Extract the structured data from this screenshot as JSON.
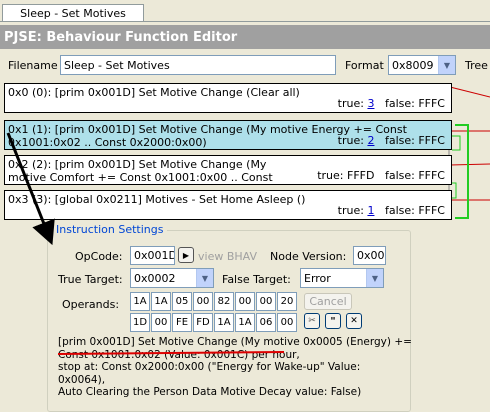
{
  "tab": {
    "label": "Sleep - Set Motives"
  },
  "header": {
    "title": "PJSE: Behaviour Function Editor"
  },
  "filename": {
    "label": "Filename",
    "value": "Sleep - Set Motives"
  },
  "format": {
    "label": "Format",
    "value": "0x8009"
  },
  "tree": {
    "label": "Tree"
  },
  "nodes": [
    {
      "text": "0x0 (0): [prim 0x001D] Set Motive Change (Clear all)",
      "true_label": "true:",
      "true_val": "3",
      "false_label": "false:",
      "false_val": "FFFC"
    },
    {
      "text": "0x1 (1): [prim 0x001D] Set Motive Change (My motive Energy += Const 0x1001:0x02 .. Const 0x2000:0x00)",
      "true_label": "true:",
      "true_val": "2",
      "false_label": "false:",
      "false_val": "FFFC"
    },
    {
      "text": "0x2 (2): [prim 0x001D] Set Motive Change (My motive Comfort += Const 0x1001:0x00 .. Const 0x1001:0x01)",
      "true_label": "true:",
      "true_val": "FFFD",
      "false_label": "false:",
      "false_val": "FFFC"
    },
    {
      "text": "0x3 (3): [global 0x0211] Motives - Set Home Asleep ()",
      "true_label": "true:",
      "true_val": "1",
      "false_label": "false:",
      "false_val": "FFFC"
    }
  ],
  "settings": {
    "title": "Instruction Settings",
    "opcode_label": "OpCode:",
    "opcode_value": "0x001D",
    "view_bhav": "view BHAV",
    "node_version_label": "Node Version:",
    "node_version_value": "0x00",
    "true_target_label": "True Target:",
    "true_target_value": "0x0002",
    "false_target_label": "False Target:",
    "false_target_value": "Error",
    "operands_label": "Operands:",
    "operands_row1": [
      "1A",
      "1A",
      "05",
      "00",
      "82",
      "00",
      "00",
      "20"
    ],
    "operands_row2": [
      "1D",
      "00",
      "FE",
      "FD",
      "1A",
      "1A",
      "06",
      "00"
    ],
    "cancel_label": "Cancel",
    "description": [
      "[prim 0x001D] Set Motive Change (My motive 0x0005 (Energy) +=",
      "Const 0x1001:0x02 (Value: 0x001C) per hour,",
      "  stop at: Const 0x2000:0x00 (\"Energy for Wake-up\" Value:",
      "  0x0064),",
      "  Auto Clearing the Person Data Motive Decay value: False)"
    ]
  },
  "colors": {
    "selected_node": "#aee0ea",
    "accent_link": "#0000cc",
    "true_arrow": "#22cc22",
    "false_arrow": "#cc0000",
    "annotation": "#dd0000"
  }
}
